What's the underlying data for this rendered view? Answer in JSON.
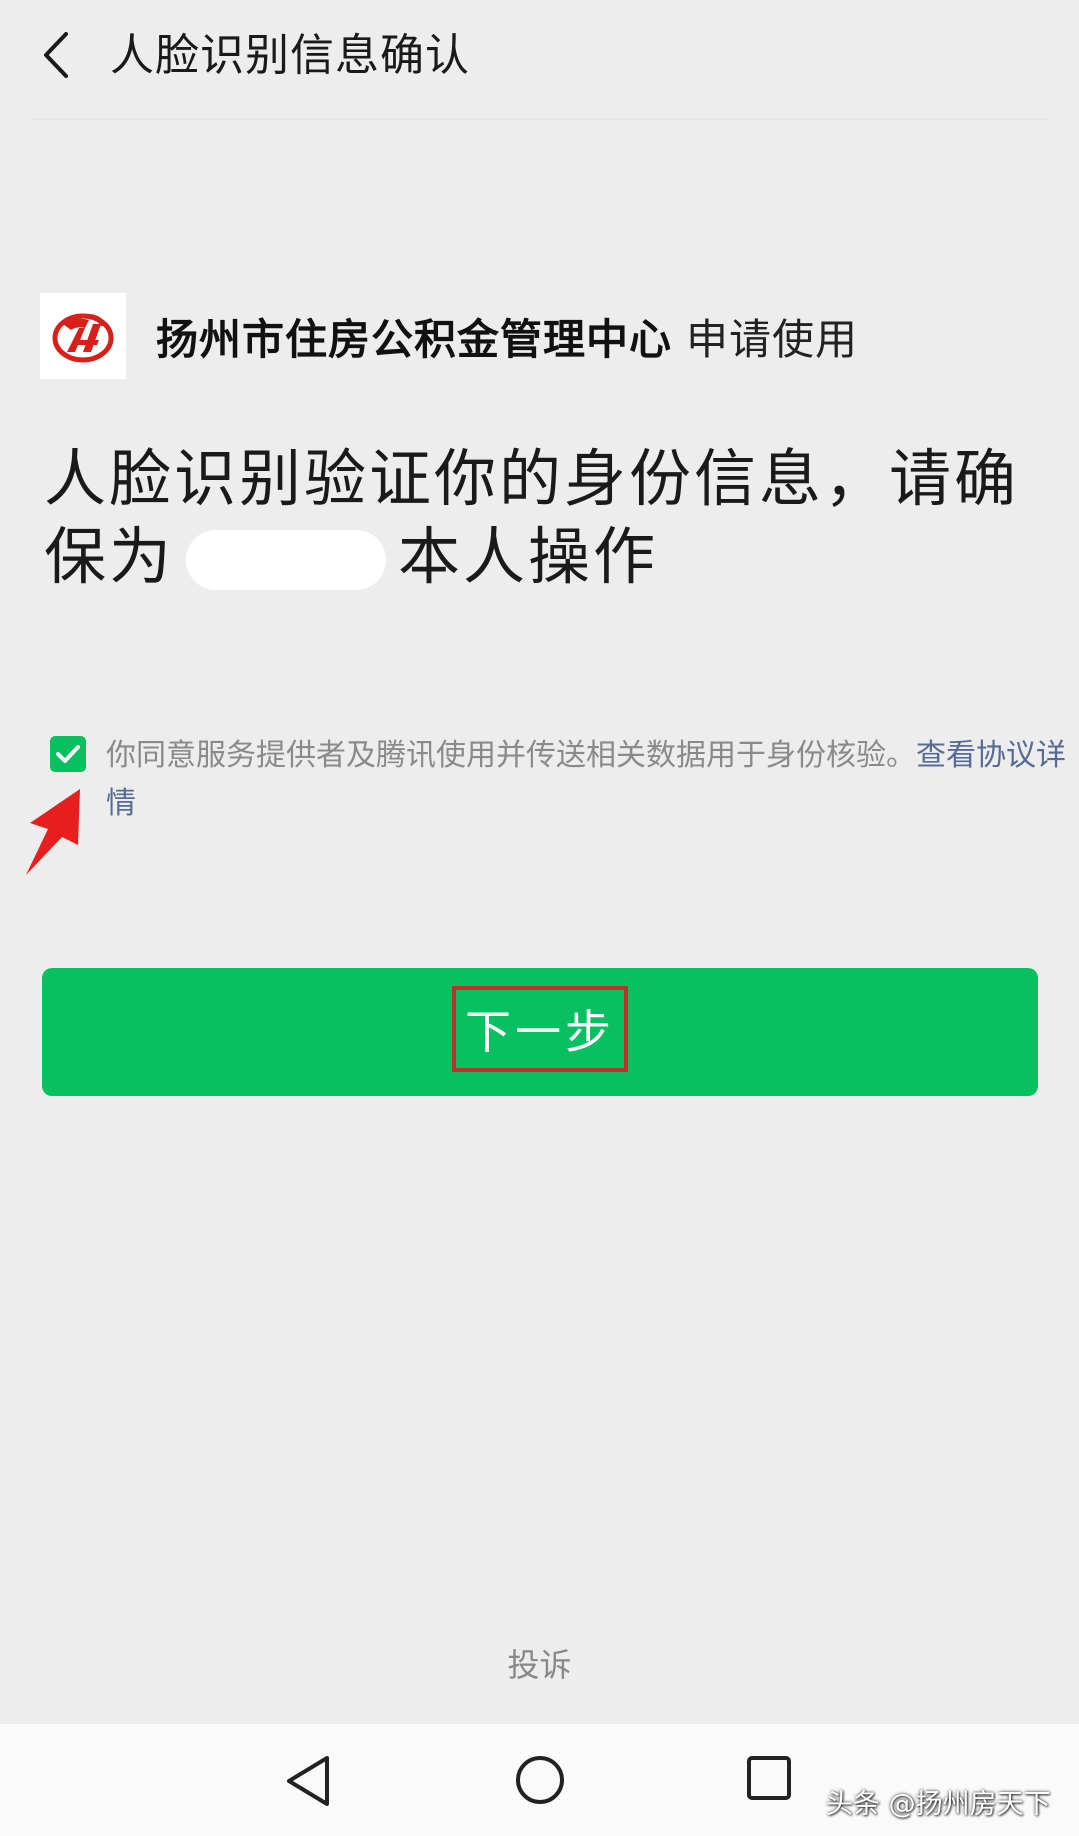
{
  "header": {
    "back_icon": "chevron-left-icon",
    "title": "人脸识别信息确认"
  },
  "org": {
    "logo_icon": "yangzhou-housing-fund-logo",
    "name": "扬州市住房公积金管理中心",
    "suffix": "申请使用"
  },
  "main": {
    "line1": "人脸识别验证你的身份信息，请确",
    "line2_prefix": "保为",
    "line2_suffix": "本人操作"
  },
  "consent": {
    "checked": true,
    "text": "你同意服务提供者及腾讯使用并传送相关数据用于身份核验。",
    "link": "查看协议详情"
  },
  "next_button": {
    "label": "下一步"
  },
  "complaint": {
    "label": "投诉"
  },
  "navbar": {
    "back_icon": "triangle-back-icon",
    "home_icon": "circle-home-icon",
    "recent_icon": "square-recent-icon"
  },
  "watermark": {
    "text": "头条 @扬州房天下"
  },
  "colors": {
    "background": "#ededed",
    "primary_green": "#07c160",
    "link_blue": "#576b95",
    "annotation_red": "#c0302a"
  }
}
